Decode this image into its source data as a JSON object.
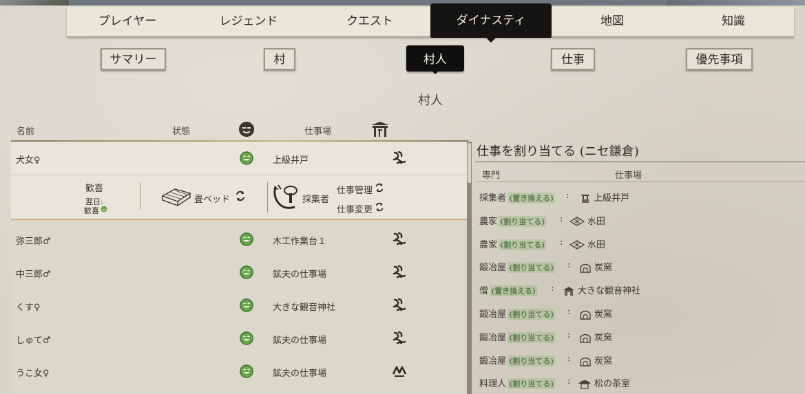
{
  "top_tabs": [
    "プレイヤー",
    "レジェンド",
    "クエスト",
    "ダイナスティ",
    "地図",
    "知識"
  ],
  "sub_tabs": [
    "サマリー",
    "村",
    "村人",
    "仕事",
    "優先事項"
  ],
  "section_title": "村人",
  "columns": {
    "name": "名前",
    "status": "状態",
    "workplace": "仕事場"
  },
  "villagers": [
    {
      "name": "犬女♀",
      "workplace": "上級井戸"
    },
    {
      "name": "弥三郎♂",
      "workplace": "木工作業台１"
    },
    {
      "name": "中三郎♂",
      "workplace": "鉱夫の仕事場"
    },
    {
      "name": "くす♀",
      "workplace": "大きな観音神社"
    },
    {
      "name": "しゅて♂",
      "workplace": "鉱夫の仕事場"
    },
    {
      "name": "うこ女♀",
      "workplace": "鉱夫の仕事場"
    }
  ],
  "detail": {
    "mood": "歓喜",
    "next_day_label": "翌日:",
    "next_day_value": "歓喜",
    "bed": "畳ベッド",
    "profession": "採集者",
    "manage_job": "仕事管理",
    "change_job": "仕事変更"
  },
  "assign": {
    "title": "仕事を割り当てる (ニセ鎌倉)",
    "col_specialty": "専門",
    "col_workplace": "仕事場",
    "rows": [
      {
        "role": "採集者",
        "tag": "(置き換える)",
        "workplace": "上級井戸",
        "icon": "well-icon"
      },
      {
        "role": "農家",
        "tag": "(割り当てる)",
        "workplace": "水田",
        "icon": "paddy-icon"
      },
      {
        "role": "農家",
        "tag": "(割り当てる)",
        "workplace": "水田",
        "icon": "paddy-icon"
      },
      {
        "role": "鍛冶屋",
        "tag": "(割り当てる)",
        "workplace": "炭窯",
        "icon": "kiln-icon"
      },
      {
        "role": "僧",
        "tag": "(置き換える)",
        "workplace": "大きな観音神社",
        "icon": "shrine-icon"
      },
      {
        "role": "鍛冶屋",
        "tag": "(割り当てる)",
        "workplace": "炭窯",
        "icon": "kiln-icon"
      },
      {
        "role": "鍛冶屋",
        "tag": "(割り当てる)",
        "workplace": "炭窯",
        "icon": "kiln-icon"
      },
      {
        "role": "鍛冶屋",
        "tag": "(割り当てる)",
        "workplace": "炭窯",
        "icon": "kiln-icon"
      },
      {
        "role": "料理人",
        "tag": "(割り当てる)",
        "workplace": "松の茶室",
        "icon": "teahouse-icon"
      }
    ]
  }
}
